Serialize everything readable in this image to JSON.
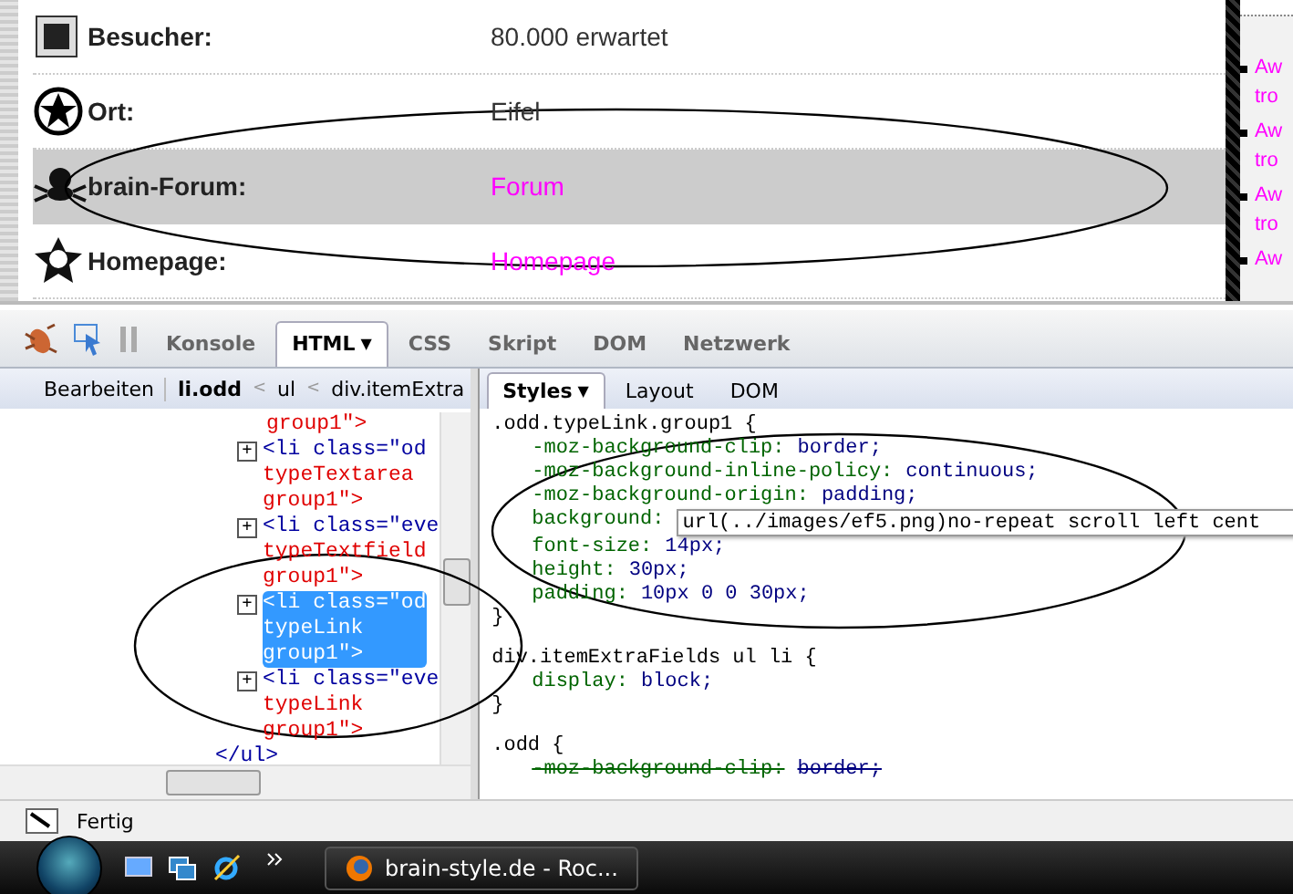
{
  "page": {
    "rows": [
      {
        "label": "Besucher:",
        "value": "80.000 erwartet",
        "link": false,
        "selected": false
      },
      {
        "label": "Ort:",
        "value": "Eifel",
        "link": false,
        "selected": false
      },
      {
        "label": "brain-Forum:",
        "value": "Forum",
        "link": true,
        "selected": true
      },
      {
        "label": "Homepage:",
        "value": "Homepage",
        "link": true,
        "selected": false
      }
    ],
    "sidebar_links": [
      [
        "Aw",
        "tro"
      ],
      [
        "Aw",
        "tro"
      ],
      [
        "Aw",
        "tro"
      ],
      [
        "Aw"
      ]
    ]
  },
  "firebug": {
    "tools": [
      {
        "label": "Konsole",
        "selected": false
      },
      {
        "label": "HTML",
        "menu_arrow": "▼",
        "selected": true
      },
      {
        "label": "CSS",
        "selected": false
      },
      {
        "label": "Skript",
        "selected": false
      },
      {
        "label": "DOM",
        "selected": false
      },
      {
        "label": "Netzwerk",
        "selected": false
      }
    ],
    "edit_button": "Bearbeiten",
    "breadcrumbs": [
      {
        "label": "li.odd",
        "separator": "<",
        "selected": true
      },
      {
        "label": "ul",
        "separator": "<",
        "selected": false
      },
      {
        "label": "div.itemExtra",
        "selected": false
      }
    ],
    "side_tabs": [
      {
        "label": "Styles",
        "menu_arrow": "▼",
        "selected": true
      },
      {
        "label": "Layout",
        "selected": false
      },
      {
        "label": "DOM",
        "selected": false
      }
    ],
    "html_tree": [
      {
        "kind": "text",
        "lines": [
          "group1\">"
        ],
        "selected": false
      },
      {
        "kind": "node",
        "toggle": "+",
        "lines": [
          "<li class=\"od",
          "typeTextarea",
          "group1\">"
        ],
        "selected": false
      },
      {
        "kind": "node",
        "toggle": "+",
        "lines": [
          "<li class=\"eve",
          "typeTextfield",
          "group1\">"
        ],
        "selected": false
      },
      {
        "kind": "node",
        "toggle": "+",
        "lines": [
          "<li class=\"od",
          "typeLink",
          "group1\">"
        ],
        "selected": true
      },
      {
        "kind": "node",
        "toggle": "+",
        "lines": [
          "<li class=\"eve",
          "typeLink",
          "group1\">"
        ],
        "selected": false
      },
      {
        "kind": "close",
        "lines": [
          "</ul>"
        ],
        "selected": false
      }
    ],
    "css_rules": [
      {
        "selector": ".odd.typeLink.group1 {",
        "props": [
          {
            "name": "-moz-background-clip:",
            "value": "border;",
            "overridden": false,
            "editing": false
          },
          {
            "name": "-moz-background-inline-policy:",
            "value": "continuous;",
            "overridden": false,
            "editing": false
          },
          {
            "name": "-moz-background-origin:",
            "value": "padding;",
            "overridden": false,
            "editing": false
          },
          {
            "name": "background:",
            "value": "url(../images/ef5.png)no-repeat scroll left cent",
            "overridden": false,
            "editing": true
          },
          {
            "name": "font-size:",
            "value": "14px;",
            "overridden": false,
            "editing": false
          },
          {
            "name": "height:",
            "value": "30px;",
            "overridden": false,
            "editing": false
          },
          {
            "name": "padding:",
            "value": "10px 0 0 30px;",
            "overridden": false,
            "editing": false
          }
        ],
        "close": "}"
      },
      {
        "selector": "div.itemExtraFields ul li {",
        "props": [
          {
            "name": "display:",
            "value": "block;",
            "overridden": false,
            "editing": false
          }
        ],
        "close": "}"
      },
      {
        "selector": ".odd {",
        "props": [
          {
            "name": "-moz-background-clip:",
            "value": "border;",
            "overridden": true,
            "editing": false
          }
        ]
      }
    ],
    "status": "Fertig"
  },
  "taskbar": {
    "task": "brain-style.de - Roc..."
  }
}
